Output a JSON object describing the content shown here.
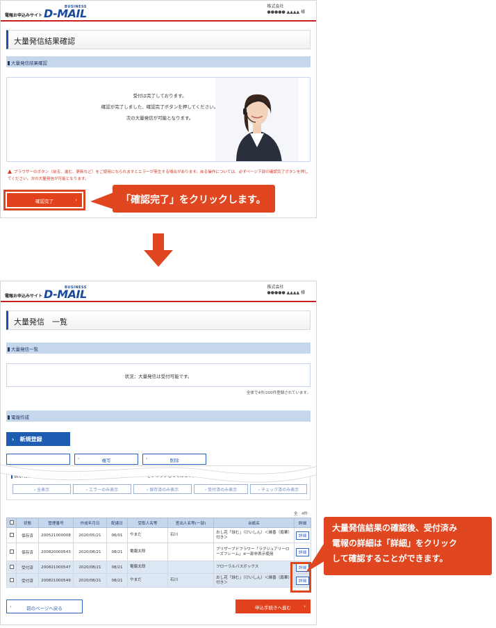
{
  "screen1": {
    "logo_prefix": "電報お申込みサイト",
    "logo_small": "BUSINESS",
    "logo_main": "D-MAIL",
    "company_line1": "株式会社",
    "company_line2": "●●●●● ▲▲▲▲ 様",
    "page_title": "大量発信結果確認",
    "section_title": "大量発信結果確認",
    "message_lines": [
      "受付は完了しております。",
      "確認が完了しました、確認完了ボタンを押してください。",
      "次の大量発信が可能となります。"
    ],
    "warning_text": "ブラウザーのボタン（戻る、進む、更新など）をご使用になられますとエラーが発生する場合があります。戻る操作については、必ずページ下部の確認完了ボタンを押してください。次の大量発信が可能となります。",
    "confirm_button": "確認完了",
    "callout_text": "「確認完了」をクリックします。"
  },
  "screen2": {
    "logo_prefix": "電報お申込みサイト",
    "logo_small": "BUSINESS",
    "logo_main": "D-MAIL",
    "company_line1": "株式会社",
    "company_line2": "●●●●● ▲▲▲▲ 様",
    "page_title": "大量発信　一覧",
    "section_title": "大量発信一覧",
    "status_text": "状況：大量発信は受付可能です。",
    "count_note": "全体で4件/200件登録されています。",
    "section2_title": "電報作成",
    "new_button": "新規登録",
    "copy_button": "複写",
    "delete_button": "削除",
    "filter_label": "表示切替",
    "filter_note": "※チェックの入っている電報は常に表示されます。　　　　をクリックしてください。",
    "filter_buttons": [
      "全表示",
      "エラーのみ表示",
      "保存済のみ表示",
      "受付済のみ表示",
      "チェック済のみ表示"
    ],
    "page_count": "全　4件",
    "table_headers": [
      "",
      "状態",
      "管理番号",
      "作成年月日",
      "配達日",
      "受取人名等",
      "差出人名等(一部)",
      "台紙名",
      "詳細"
    ],
    "rows": [
      {
        "status": "保存済",
        "id": "200521000008",
        "created": "2020/05/21",
        "delivery": "06/01",
        "recipient": "やまだ",
        "sender": "石川",
        "mount": "おし花「詠む」（けいしん）＜縁香（扇華）付き＞",
        "detail": "詳細"
      },
      {
        "status": "保存済",
        "id": "200820000543",
        "created": "2020/08/21",
        "delivery": "08/21",
        "recipient": "電報太郎",
        "sender": "",
        "mount": "プリザーブドフラワー「ラグジュアリーローズフレーム」※一部非表示使用",
        "detail": "詳細"
      },
      {
        "status": "受付済",
        "id": "200821000547",
        "created": "2020/08/21",
        "delivery": "08/21",
        "recipient": "電報太郎",
        "sender": "",
        "mount": "フローラルバスボックス",
        "detail": "詳細"
      },
      {
        "status": "受付済",
        "id": "200821000549",
        "created": "2020/08/21",
        "delivery": "08/21",
        "recipient": "やまだ",
        "sender": "石川",
        "mount": "おし花「詠む」（けいしん）＜縁香（扇華）付き＞",
        "detail": "詳細"
      }
    ],
    "back_button": "前のページへ戻る",
    "proceed_button": "申込手続きへ進む",
    "callout_lines": [
      "大量発信結果の確認後、受付済み",
      "電報の詳細は「詳細」をクリック",
      "して確認することができます。"
    ]
  },
  "colors": {
    "accent_red": "#e2411c",
    "brand_blue": "#1d5cb0",
    "section_bg": "#c7d7eb"
  }
}
